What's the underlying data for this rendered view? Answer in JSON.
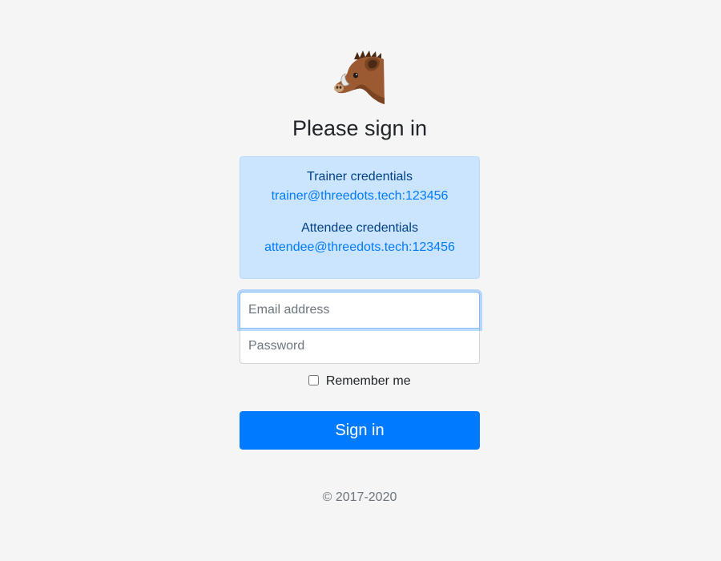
{
  "logo": {
    "icon": "boar-icon"
  },
  "title": "Please sign in",
  "credentials": {
    "trainer_heading": "Trainer credentials",
    "trainer_link": "trainer@threedots.tech:123456",
    "attendee_heading": "Attendee credentials",
    "attendee_link": "attendee@threedots.tech:123456"
  },
  "form": {
    "email_placeholder": "Email address",
    "email_value": "",
    "password_placeholder": "Password",
    "password_value": "",
    "remember_label": "Remember me",
    "remember_checked": false,
    "submit_label": "Sign in"
  },
  "footer": {
    "copyright": "© 2017-2020"
  },
  "colors": {
    "page_background": "#f5f5f5",
    "primary": "#007bff",
    "alert_background": "#cce5ff",
    "alert_border": "#b8daff",
    "alert_text": "#004085",
    "muted_text": "#6c757d"
  }
}
